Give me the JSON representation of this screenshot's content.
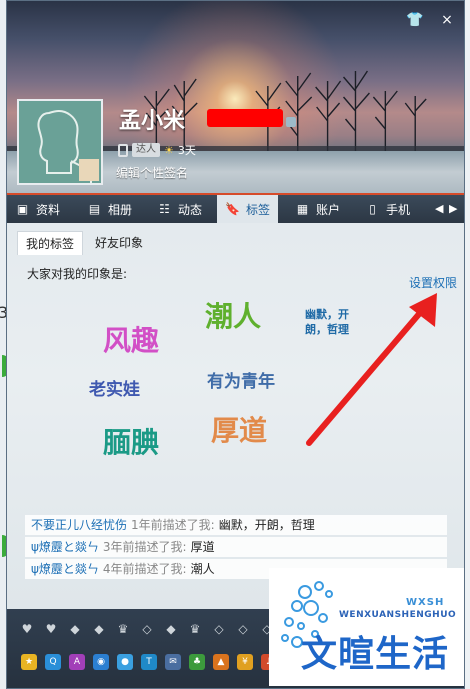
{
  "window": {
    "close_label": "×",
    "min_label": "–"
  },
  "profile": {
    "name": "孟小米",
    "badge": "达人",
    "days": "3天",
    "signature": "编辑个性签名"
  },
  "tabs": [
    {
      "label": "资料",
      "icon": "profile-card-icon"
    },
    {
      "label": "相册",
      "icon": "photo-album-icon"
    },
    {
      "label": "动态",
      "icon": "feed-icon"
    },
    {
      "label": "标签",
      "icon": "bookmark-tag-icon",
      "active": true
    },
    {
      "label": "账户",
      "icon": "briefcase-icon"
    },
    {
      "label": "手机",
      "icon": "mobile-phone-icon"
    }
  ],
  "subtabs": {
    "mine": "我的标签",
    "friends": "好友印象"
  },
  "intro": "大家对我的印象是:",
  "settings_link": "设置权限",
  "tags": [
    {
      "text": "风趣",
      "color": "#d24fc6"
    },
    {
      "text": "潮人",
      "color": "#5fb02e"
    },
    {
      "text": "幽默，开朗，哲理",
      "color": "#1f6aa6"
    },
    {
      "text": "老实娃",
      "color": "#3f59b0"
    },
    {
      "text": "有为青年",
      "color": "#3f6ca8"
    },
    {
      "text": "腼腆",
      "color": "#1b9a86"
    },
    {
      "text": "厚道",
      "color": "#e28a4a"
    }
  ],
  "recent": [
    {
      "who": "不要正儿八经忧伤",
      "when": "1年前描述了我:",
      "tags": "幽默，开朗，哲理"
    },
    {
      "who": "ψ燎靂と燚ㄣ",
      "when": "3年前描述了我:",
      "tags": "厚道"
    },
    {
      "who": "ψ燎靂と燚ㄣ",
      "when": "4年前描述了我:",
      "tags": "潮人"
    }
  ],
  "watermark": {
    "latin": "WENXUANSHENGHUO",
    "pinyin": "WXSH",
    "chinese": "文暄生活"
  },
  "colors": {
    "arrow": "#e8201f",
    "accent": "#1c6fb5",
    "tabbar": "#2c3744"
  }
}
